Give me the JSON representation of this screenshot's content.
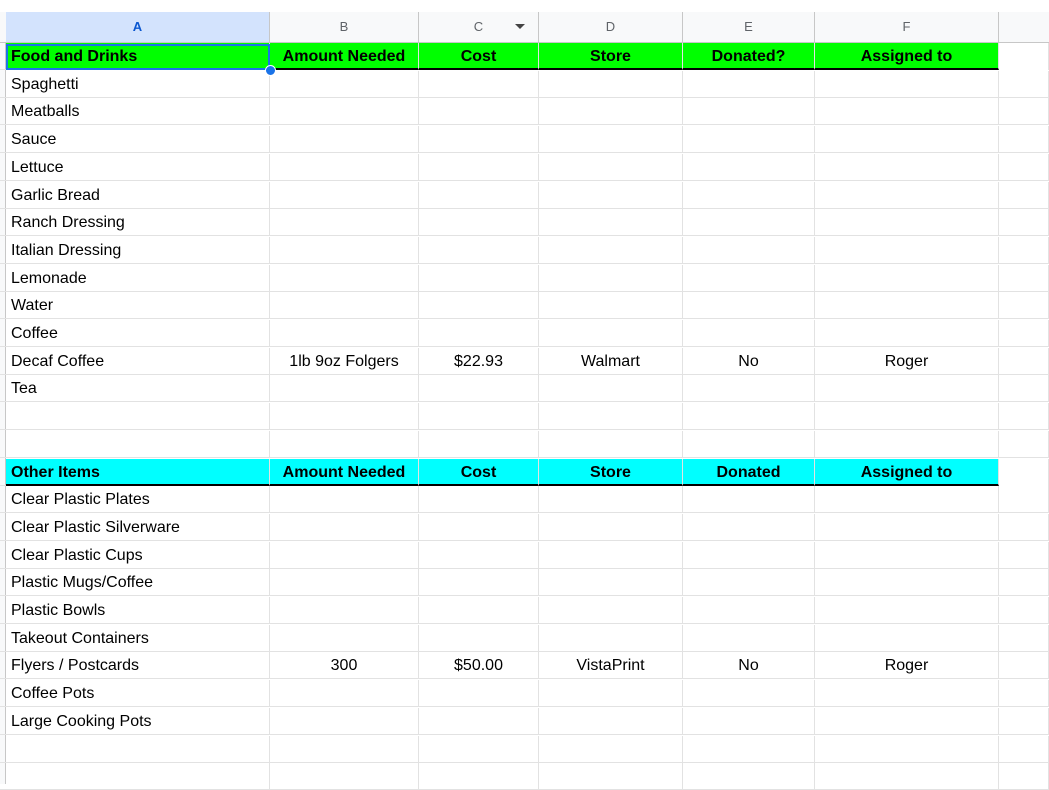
{
  "columns": [
    {
      "letter": "A"
    },
    {
      "letter": "B"
    },
    {
      "letter": "C"
    },
    {
      "letter": "D"
    },
    {
      "letter": "E"
    },
    {
      "letter": "F"
    }
  ],
  "food_table": {
    "headers": [
      "Food and Drinks",
      "Amount Needed",
      "Cost",
      "Store",
      "Donated?",
      "Assigned to"
    ],
    "header_color": "#00ff00",
    "rows": [
      [
        "Spaghetti",
        "",
        "",
        "",
        "",
        ""
      ],
      [
        "Meatballs",
        "",
        "",
        "",
        "",
        ""
      ],
      [
        "Sauce",
        "",
        "",
        "",
        "",
        ""
      ],
      [
        "Lettuce",
        "",
        "",
        "",
        "",
        ""
      ],
      [
        "Garlic Bread",
        "",
        "",
        "",
        "",
        ""
      ],
      [
        "Ranch Dressing",
        "",
        "",
        "",
        "",
        ""
      ],
      [
        "Italian Dressing",
        "",
        "",
        "",
        "",
        ""
      ],
      [
        "Lemonade",
        "",
        "",
        "",
        "",
        ""
      ],
      [
        "Water",
        "",
        "",
        "",
        "",
        ""
      ],
      [
        "Coffee",
        "",
        "",
        "",
        "",
        ""
      ],
      [
        "Decaf Coffee",
        "1lb 9oz Folgers",
        "$22.93",
        "Walmart",
        "No",
        "Roger"
      ],
      [
        "Tea",
        "",
        "",
        "",
        "",
        ""
      ]
    ]
  },
  "other_table": {
    "headers": [
      "Other Items",
      "Amount Needed",
      "Cost",
      "Store",
      "Donated",
      "Assigned to"
    ],
    "header_color": "#00ffff",
    "rows": [
      [
        "Clear Plastic Plates",
        "",
        "",
        "",
        "",
        ""
      ],
      [
        "Clear Plastic Silverware",
        "",
        "",
        "",
        "",
        ""
      ],
      [
        "Clear Plastic Cups",
        "",
        "",
        "",
        "",
        ""
      ],
      [
        "Plastic Mugs/Coffee",
        "",
        "",
        "",
        "",
        ""
      ],
      [
        "Plastic Bowls",
        "",
        "",
        "",
        "",
        ""
      ],
      [
        "Takeout Containers",
        "",
        "",
        "",
        "",
        ""
      ],
      [
        "Flyers / Postcards",
        "300",
        "$50.00",
        "VistaPrint",
        "No",
        "Roger"
      ],
      [
        "Coffee Pots",
        "",
        "",
        "",
        "",
        ""
      ],
      [
        "Large Cooking Pots",
        "",
        "",
        "",
        "",
        ""
      ]
    ]
  },
  "selection": {
    "cell": "A1"
  },
  "colors": {
    "selection": "#1a73e8",
    "selected_header_bg": "#d3e3fd"
  }
}
